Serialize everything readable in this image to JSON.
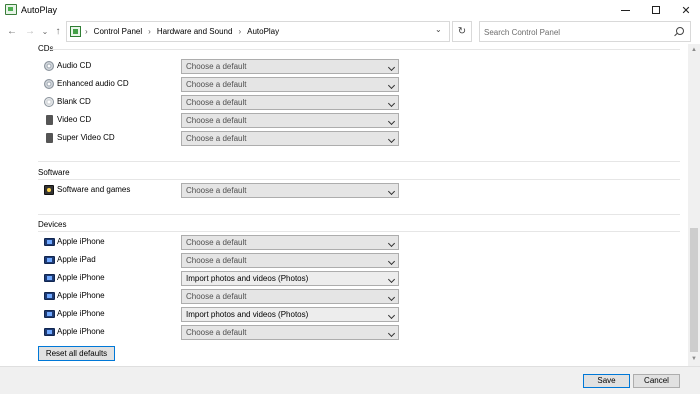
{
  "window": {
    "title": "AutoPlay",
    "minimize_glyph": "—",
    "close_glyph": "✕"
  },
  "nav": {
    "back_glyph": "←",
    "forward_glyph": "→",
    "recent_glyph": "⌄",
    "up_glyph": "↑"
  },
  "address": {
    "crumbs": [
      "Control Panel",
      "Hardware and Sound",
      "AutoPlay"
    ],
    "separator": "›",
    "dropdown_glyph": "⌄",
    "refresh_glyph": "↻"
  },
  "search": {
    "placeholder": "Search Control Panel"
  },
  "sections": [
    {
      "title": "CDs",
      "rows": [
        {
          "label": "Audio CD",
          "value": "Choose a default",
          "icon": "audio-cd-icon"
        },
        {
          "label": "Enhanced audio CD",
          "value": "Choose a default",
          "icon": "enhanced-audio-cd-icon"
        },
        {
          "label": "Blank CD",
          "value": "Choose a default",
          "icon": "blank-cd-icon"
        },
        {
          "label": "Video CD",
          "value": "Choose a default",
          "icon": "video-cd-icon"
        },
        {
          "label": "Super Video CD",
          "value": "Choose a default",
          "icon": "super-video-cd-icon"
        }
      ]
    },
    {
      "title": "Software",
      "rows": [
        {
          "label": "Software and games",
          "value": "Choose a default",
          "icon": "software-games-icon"
        }
      ]
    },
    {
      "title": "Devices",
      "rows": [
        {
          "label": "Apple iPhone",
          "value": "Choose a default",
          "icon": "apple-device-icon"
        },
        {
          "label": "Apple iPad",
          "value": "Choose a default",
          "icon": "apple-device-icon"
        },
        {
          "label": "Apple iPhone",
          "value": "Import photos and videos (Photos)",
          "icon": "apple-device-icon"
        },
        {
          "label": "Apple iPhone",
          "value": "Choose a default",
          "icon": "apple-device-icon"
        },
        {
          "label": "Apple iPhone",
          "value": "Import photos and videos (Photos)",
          "icon": "apple-device-icon"
        },
        {
          "label": "Apple iPhone",
          "value": "Choose a default",
          "icon": "apple-device-icon"
        }
      ]
    }
  ],
  "reset_label": "Reset all defaults",
  "footer": {
    "save_label": "Save",
    "cancel_label": "Cancel"
  },
  "scrollbar": {
    "up_glyph": "▲",
    "down_glyph": "▼"
  },
  "colors": {
    "accent": "#0078d7",
    "combo_bg": "#e5e5e5",
    "footer_bg": "#f0f0f0"
  }
}
